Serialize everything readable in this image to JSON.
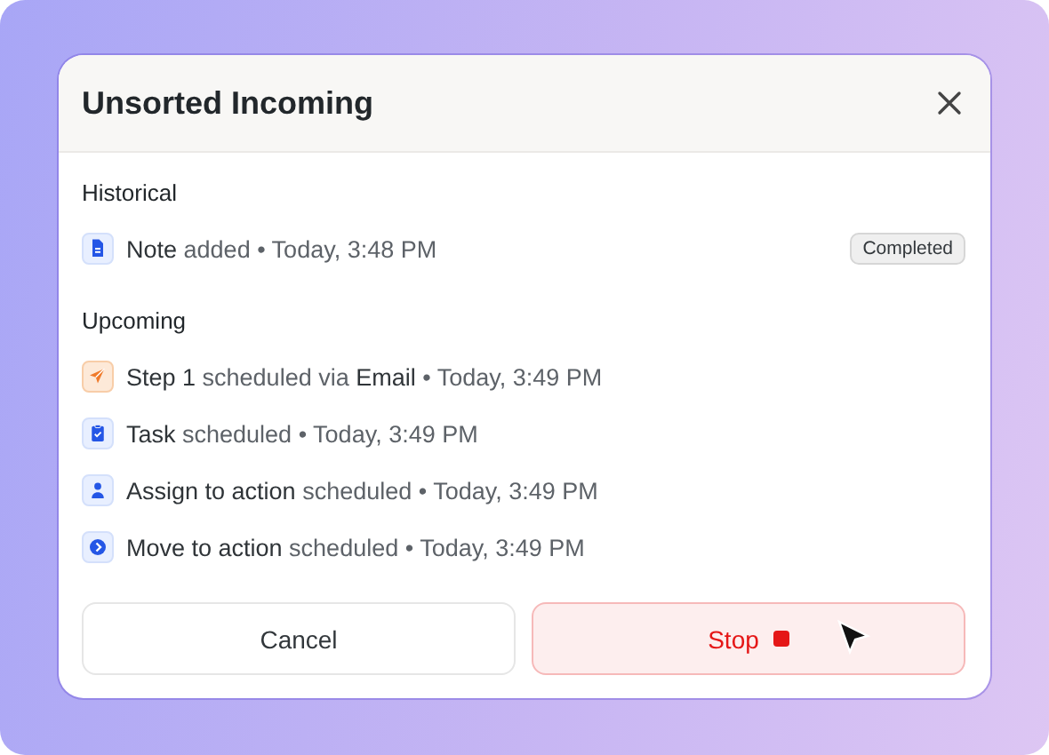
{
  "dialog": {
    "title": "Unsorted Incoming"
  },
  "sections": [
    {
      "heading": "Historical",
      "items": [
        {
          "kind": "note",
          "text": "**Note** added • Today, 3:48 PM",
          "badge": "Completed"
        }
      ]
    },
    {
      "heading": "Upcoming",
      "items": [
        {
          "kind": "email",
          "text": "**Step 1** scheduled via **Email** • Today, 3:49 PM"
        },
        {
          "kind": "task",
          "text": "**Task** scheduled • Today, 3:49 PM"
        },
        {
          "kind": "assign",
          "text": "**Assign to action** scheduled • Today, 3:49 PM"
        },
        {
          "kind": "move",
          "text": "**Move to action** scheduled • Today, 3:49 PM"
        }
      ]
    }
  ],
  "buttons": [
    {
      "kind": "secondary",
      "label": "Cancel"
    },
    {
      "kind": "danger",
      "label": "Stop"
    }
  ]
}
